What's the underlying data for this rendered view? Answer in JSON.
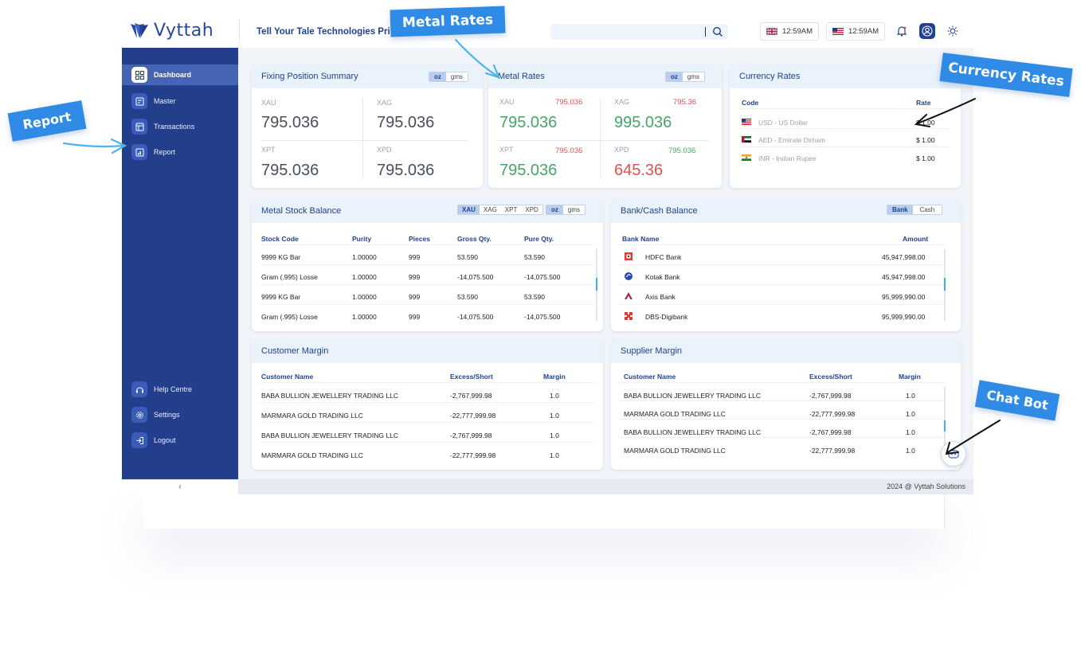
{
  "app": {
    "logo_text": "Vyttah",
    "company": "Tell Your Tale Technologies Priva",
    "search_placeholder": ""
  },
  "header": {
    "clocks": [
      {
        "flag": "uk",
        "time": "12:59AM"
      },
      {
        "flag": "us",
        "time": "12:59AM"
      }
    ],
    "icons": [
      "bell-icon",
      "user-icon",
      "sun-icon"
    ]
  },
  "sidebar": {
    "items": [
      {
        "label": "Dashboard",
        "icon": "dashboard-icon",
        "active": true
      },
      {
        "label": "Master",
        "icon": "master-icon"
      },
      {
        "label": "Transactions",
        "icon": "transactions-icon"
      },
      {
        "label": "Report",
        "icon": "report-icon"
      }
    ],
    "bottom": [
      {
        "label": "Help Centre",
        "icon": "help-icon"
      },
      {
        "label": "Settings",
        "icon": "settings-icon"
      },
      {
        "label": "Logout",
        "icon": "logout-icon"
      }
    ],
    "collapse": "‹"
  },
  "fixing": {
    "title": "Fixing Position Summary",
    "toggle": [
      "oz",
      "gms"
    ],
    "cells": [
      {
        "code": "XAU",
        "value": "795.036"
      },
      {
        "code": "XAG",
        "value": "795.036"
      },
      {
        "code": "XPT",
        "value": "795.036"
      },
      {
        "code": "XPD",
        "value": "795.036"
      }
    ]
  },
  "metal_rates": {
    "title": "Metal Rates",
    "toggle": [
      "oz",
      "gms"
    ],
    "cells": [
      {
        "code": "XAU",
        "small": "795.036",
        "value": "795.036"
      },
      {
        "code": "XAG",
        "small": "795.36",
        "value": "995.036"
      },
      {
        "code": "XPT",
        "small": "795.036",
        "value": "795.036"
      },
      {
        "code": "XPD",
        "small": "795.036",
        "value": "645.36"
      }
    ]
  },
  "currency": {
    "title": "Currency Rates",
    "col_code": "Code",
    "col_rate": "Rate",
    "rows": [
      {
        "flag": "us",
        "label": "USD - US Dollar",
        "rate": "$ 1.00"
      },
      {
        "flag": "ae",
        "label": "AED - Emirate Dirham",
        "rate": "$ 1.00"
      },
      {
        "flag": "in",
        "label": "INR - Indian Rupee",
        "rate": "$ 1.00"
      }
    ]
  },
  "stock": {
    "title": "Metal Stock Balance",
    "metal_toggle": [
      "XAU",
      "XAG",
      "XPT",
      "XPD"
    ],
    "unit_toggle": [
      "oz",
      "gms"
    ],
    "headers": [
      "Stock Code",
      "Purity",
      "Pieces",
      "Gross Qty.",
      "Pure Qty."
    ],
    "rows": [
      [
        "9999 KG Bar",
        "1.00000",
        "999",
        "53.590",
        "53.590"
      ],
      [
        "Gram (.995) Losse",
        "1.00000",
        "999",
        "-14,075.500",
        "-14,075.500"
      ],
      [
        "9999 KG Bar",
        "1.00000",
        "999",
        "53.590",
        "53.590"
      ],
      [
        "Gram (.995) Losse",
        "1.00000",
        "999",
        "-14,075.500",
        "-14,075.500"
      ]
    ]
  },
  "bank": {
    "title": "Bank/Cash Balance",
    "toggle": [
      "Bank",
      "Cash"
    ],
    "headers": [
      "Bank Name",
      "Amount"
    ],
    "rows": [
      {
        "icon": "hdfc-icon",
        "name": "HDFC Bank",
        "amount": "45,947,998.00"
      },
      {
        "icon": "kotak-icon",
        "name": "Kotak Bank",
        "amount": "45,947,998.00"
      },
      {
        "icon": "axis-icon",
        "name": "Axis Bank",
        "amount": "95,999,990.00"
      },
      {
        "icon": "dbs-icon",
        "name": "DBS-Digibank",
        "amount": "95,999,990.00"
      }
    ]
  },
  "customer_margin": {
    "title": "Customer Margin",
    "headers": [
      "Customer Name",
      "Excess/Short",
      "Margin"
    ],
    "rows": [
      [
        "BABA BULLION JEWELLERY TRADING LLC",
        "-2,767,999.98",
        "1.0"
      ],
      [
        "MARMARA GOLD TRADING LLC",
        "-22,777,999.98",
        "1.0"
      ],
      [
        "BABA BULLION JEWELLERY TRADING LLC",
        "-2,767,999.98",
        "1.0"
      ],
      [
        "MARMARA GOLD TRADING LLC",
        "-22,777,999.98",
        "1.0"
      ]
    ]
  },
  "supplier_margin": {
    "title": "Supplier Margin",
    "headers": [
      "Customer Name",
      "Excess/Short",
      "Margin"
    ],
    "rows": [
      [
        "BABA BULLION JEWELLERY TRADING LLC",
        "-2,767,999.98",
        "1.0"
      ],
      [
        "MARMARA GOLD TRADING LLC",
        "-22,777,999.98",
        "1.0"
      ],
      [
        "BABA BULLION JEWELLERY TRADING LLC",
        "-2,767,999.98",
        "1.0"
      ],
      [
        "MARMARA GOLD TRADING LLC",
        "-22,777,999.98",
        "1.0"
      ]
    ]
  },
  "footer": "2024 @ Vyttah Solutions",
  "callouts": {
    "metal_rates": "Metal Rates",
    "currency_rates": "Currency Rates",
    "report": "Report",
    "chat_bot": "Chat Bot"
  },
  "colors": {
    "sidebar": "#233f8c",
    "accent": "#2f8be6",
    "positive": "#45a763",
    "negative": "#e05252"
  }
}
